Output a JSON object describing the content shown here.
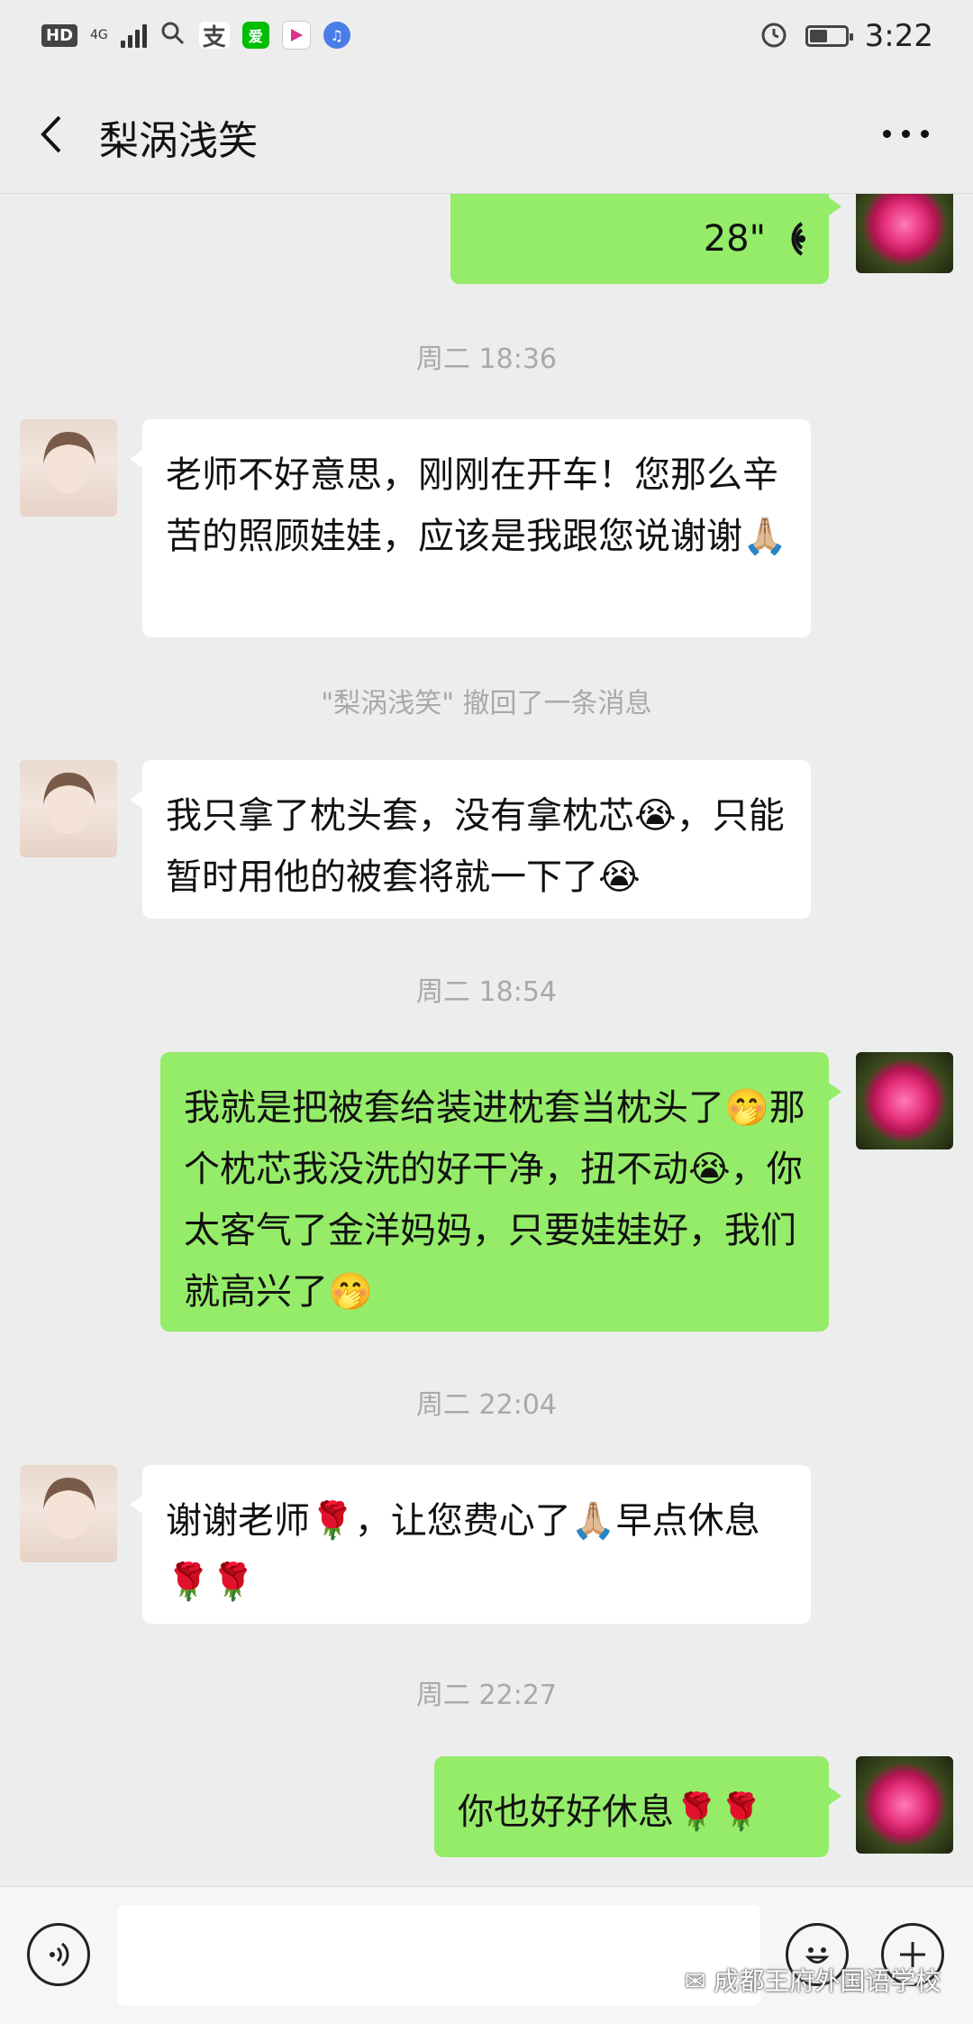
{
  "status_bar": {
    "hd": "HD",
    "network": "4G",
    "time": "3:22",
    "app_icons": [
      "search-icon",
      "alipay-icon",
      "iqiyi-icon",
      "video-app-icon",
      "music-icon"
    ]
  },
  "header": {
    "title": "梨涡浅笑"
  },
  "messages": [
    {
      "kind": "voice",
      "side": "out",
      "duration": "28\""
    },
    {
      "kind": "time",
      "text": "周二 18:36"
    },
    {
      "kind": "text",
      "side": "in",
      "text": "老师不好意思，刚刚在开车！您那么辛苦的照顾娃娃，应该是我跟您说谢谢🙏🏼"
    },
    {
      "kind": "system",
      "text": "\"梨涡浅笑\" 撤回了一条消息"
    },
    {
      "kind": "text",
      "side": "in",
      "text": "我只拿了枕头套，没有拿枕芯😭，只能暂时用他的被套将就一下了😭"
    },
    {
      "kind": "time",
      "text": "周二 18:54"
    },
    {
      "kind": "text",
      "side": "out",
      "text": "我就是把被套给装进枕套当枕头了🤭那个枕芯我没洗的好干净，扭不动😭，你太客气了金洋妈妈，只要娃娃好，我们就高兴了🤭"
    },
    {
      "kind": "time",
      "text": "周二 22:04"
    },
    {
      "kind": "text",
      "side": "in",
      "text": "谢谢老师🌹，让您费心了🙏🏼早点休息🌹🌹"
    },
    {
      "kind": "time",
      "text": "周二 22:27"
    },
    {
      "kind": "text",
      "side": "out",
      "text": "你也好好休息🌹🌹"
    }
  ],
  "input_bar": {
    "voice_icon": "voice-input-icon",
    "emoji_icon": "emoji-icon",
    "plus_icon": "plus-icon"
  },
  "watermark": "成都王府外国语学校"
}
